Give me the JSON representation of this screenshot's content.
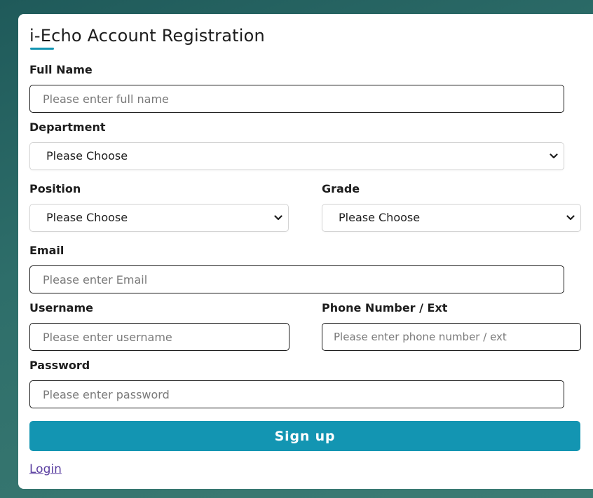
{
  "form": {
    "title": "i-Echo Account Registration",
    "full_name": {
      "label": "Full Name",
      "placeholder": "Please enter full name"
    },
    "department": {
      "label": "Department",
      "selected": "Please Choose"
    },
    "position": {
      "label": "Position",
      "selected": "Please Choose"
    },
    "grade": {
      "label": "Grade",
      "selected": "Please Choose"
    },
    "email": {
      "label": "Email",
      "placeholder": "Please enter Email"
    },
    "username": {
      "label": "Username",
      "placeholder": "Please enter username"
    },
    "phone": {
      "label": "Phone Number / Ext",
      "placeholder": "Please enter phone number / ext"
    },
    "password": {
      "label": "Password",
      "placeholder": "Please enter password"
    },
    "signup_label": "Sign up",
    "login_label": "Login"
  },
  "colors": {
    "accent": "#1395b2",
    "link": "#5a3ea0",
    "background": "#2e6e6a"
  },
  "icons": {
    "select_arrow": "chevron-down-icon"
  }
}
